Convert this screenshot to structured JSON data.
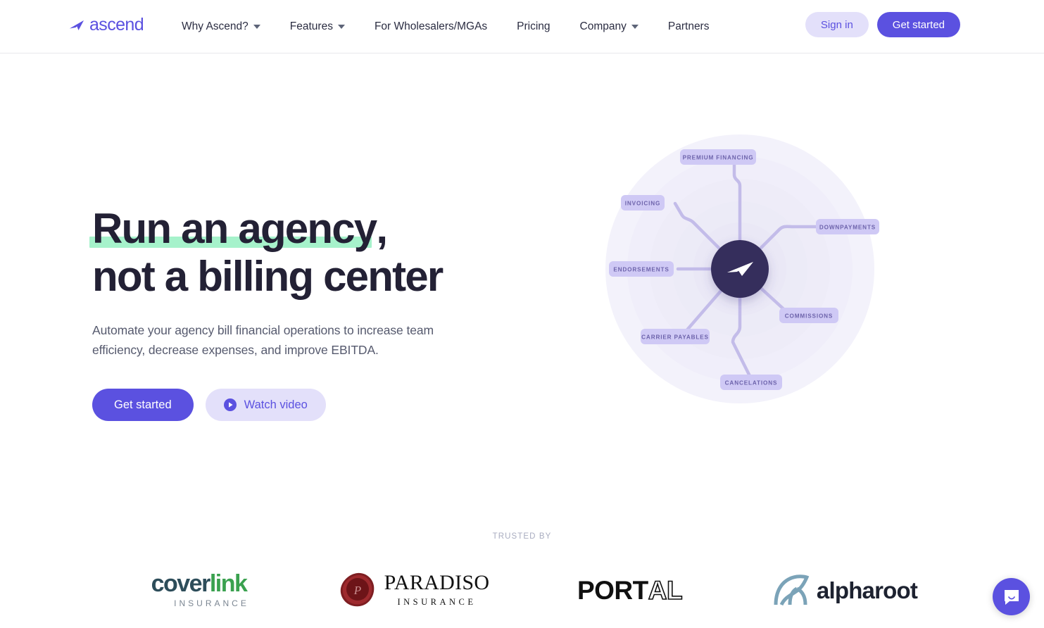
{
  "colors": {
    "brand_purple": "#5b51e0",
    "brand_purple_light": "#e3e0fa",
    "highlight_green": "#a6f2cb",
    "heading_dark": "#232135",
    "hub_dark": "#362e5c",
    "pill_bg": "#cfc9f5",
    "pill_text": "#6d63ab"
  },
  "nav": {
    "logo": {
      "icon": "ascend-swoosh-icon",
      "text": "ascend"
    },
    "links": [
      {
        "label": "Why Ascend?",
        "has_dropdown": true
      },
      {
        "label": "Features",
        "has_dropdown": true
      },
      {
        "label": "For Wholesalers/MGAs",
        "has_dropdown": false
      },
      {
        "label": "Pricing",
        "has_dropdown": false
      },
      {
        "label": "Company",
        "has_dropdown": true
      },
      {
        "label": "Partners",
        "has_dropdown": false
      }
    ],
    "sign_in": "Sign in",
    "get_started": "Get started"
  },
  "hero": {
    "title_line1": "Run an agency",
    "title_line1_tail": ",",
    "title_line2": "not a billing center",
    "subtitle": "Automate your agency bill financial operations to increase team efficiency, decrease expenses, and improve EBITDA.",
    "primary_button": "Get started",
    "secondary_button": "Watch video",
    "secondary_icon": "play-circle-icon"
  },
  "diagram": {
    "hub_icon": "ascend-swoosh-icon",
    "nodes": [
      {
        "label": "PREMIUM FINANCING"
      },
      {
        "label": "INVOICING"
      },
      {
        "label": "DOWNPAYMENTS"
      },
      {
        "label": "ENDORSEMENTS"
      },
      {
        "label": "COMMISSIONS"
      },
      {
        "label": "CARRIER PAYABLES"
      },
      {
        "label": "CANCELATIONS"
      }
    ]
  },
  "trusted": {
    "label": "TRUSTED BY",
    "logos": [
      {
        "name": "coverlink-insurance",
        "part1": "cover",
        "part2": "link",
        "subtitle": "INSURANCE"
      },
      {
        "name": "paradiso-insurance",
        "title": "PARADISO",
        "subtitle": "INSURANCE"
      },
      {
        "name": "portal",
        "part1": "PORT",
        "part2": "AL"
      },
      {
        "name": "alpharoot",
        "title": "alpharoot"
      }
    ]
  },
  "chat": {
    "icon": "chat-bubble-smile-icon"
  }
}
